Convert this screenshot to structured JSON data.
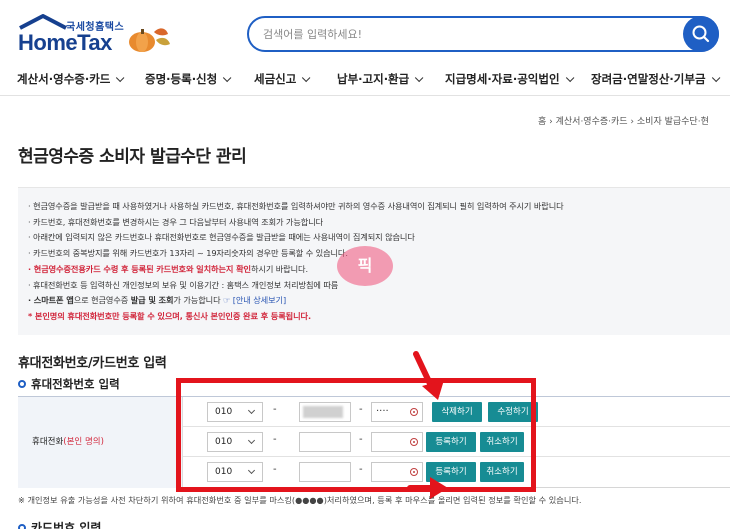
{
  "brand": {
    "small": "국세청홈택스",
    "big": "HomeTax"
  },
  "search": {
    "placeholder": "검색어를 입력하세요!"
  },
  "nav": [
    {
      "label": "계산서·영수증·카드"
    },
    {
      "label": "증명·등록·신청"
    },
    {
      "label": "세금신고"
    },
    {
      "label": "납부·고지·환급"
    },
    {
      "label": "지급명세·자료·공익법인"
    },
    {
      "label": "장려금·연말정산·기부금"
    }
  ],
  "breadcrumb": "홈  ›  계산서·영수증·카드  ›  소비자 발급수단·현",
  "page_title": "현금영수증 소비자 발급수단 관리",
  "notices": [
    {
      "text": "· 현금영수증을 발급받을 때 사용하였거나 사용하실 카드번호, 휴대전화번호를 입력하셔야만 귀하의 영수증 사용내역이 집계되니 필히 입력하여 주시기 바랍니다",
      "red": false
    },
    {
      "text": "· 카드번호, 휴대전화번호를 변경하시는 경우 그 다음날부터 사용내역 조회가 가능합니다",
      "red": false
    },
    {
      "text": "· 아래칸에 입력되지 않은 카드번호나 휴대전화번호로 현금영수증을 발급받을 때에는 사용내역이 집계되지 않습니다",
      "red": false
    },
    {
      "text": "· 카드번호의 중복방지를 위해 카드번호가 13자리 ~ 19자리숫자의 경우만 등록할 수 있습니다.",
      "red": false
    }
  ],
  "notice_red_bold": "· 현금영수증전용카드 수령 후 등록된 카드번호와 일치하는지 확인",
  "notice_red_tail": "하시기 바랍니다.",
  "notice_privacy": "· 휴대전화번호 등 입력하신 개인정보의 보유 및 이용기간 : 홈택스 개인정보 처리방침에 따름",
  "notice_app_pre": "· 스마트폰 앱",
  "notice_app_mid": "으로 현금영수증 ",
  "notice_app_b1": "발급 및 조회",
  "notice_app_post": "가 가능합니다 ",
  "notice_app_link": "☞ [안내 상세보기]",
  "notice_final": "* 본인명의 휴대전화번호만 등록할 수 있으며, 통신사 본인인증 완료 후 등록됩니다.",
  "watermark": "픽",
  "section_title": "휴대전화번호/카드번호 입력",
  "subsection_title": "휴대전화번호 입력",
  "label": {
    "main": "휴대전화",
    "note": "(본인 명의)"
  },
  "rows": [
    {
      "prefix": "010",
      "middle": "",
      "last": "····",
      "btn1": "삭제하기",
      "btn2": "수정하기"
    },
    {
      "prefix": "010",
      "middle": "",
      "last": "",
      "btn1": "등록하기",
      "btn2": "취소하기"
    },
    {
      "prefix": "010",
      "middle": "",
      "last": "",
      "btn1": "등록하기",
      "btn2": "취소하기"
    }
  ],
  "dash": "-",
  "footnote": "※ 개인정보 유출 가능성을 사전 차단하기 위하여 휴대전화번호 중 일부를 마스킹(●●●●)처리하였으며, 등록 후 마우스를 올리면 입력된 정보를 확인할 수 있습니다.",
  "next_title": "카드번호 입력",
  "colors": {
    "accent": "#1f5fc4",
    "button": "#178c94",
    "annotation": "#e3141c"
  }
}
